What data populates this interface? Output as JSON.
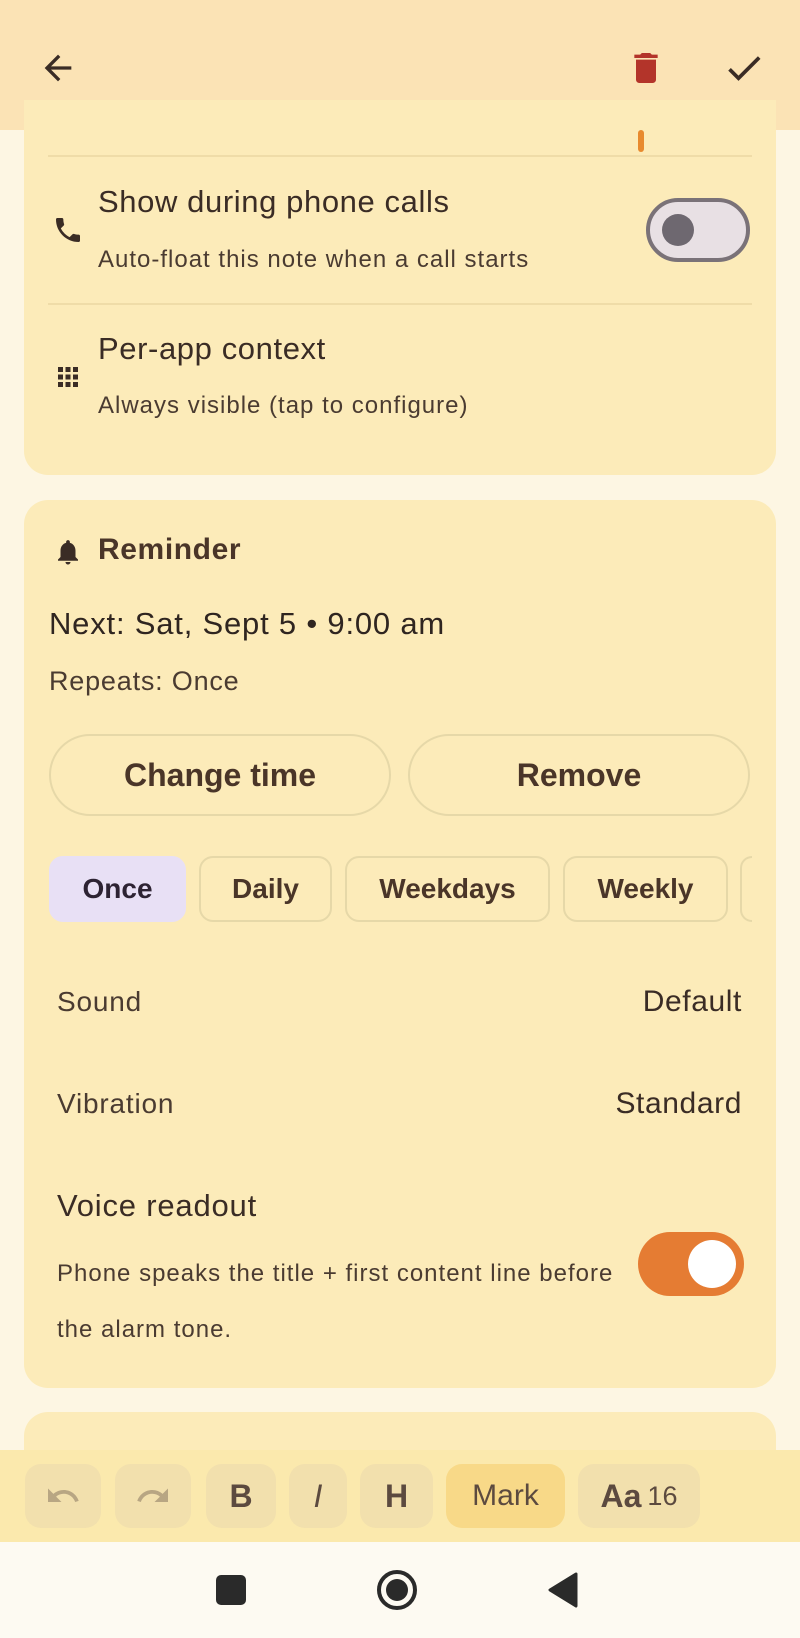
{
  "floating": {
    "phone_calls_title": "Show during phone calls",
    "phone_calls_sub": "Auto-float this note when a call starts",
    "phone_calls_on": false,
    "per_app_title": "Per-app context",
    "per_app_sub": "Always visible (tap to configure)"
  },
  "reminder": {
    "heading": "Reminder",
    "next": "Next: Sat, Sept 5 • 9:00 am",
    "repeats": "Repeats: Once",
    "change_time_label": "Change time",
    "remove_label": "Remove",
    "repeat_options": [
      "Once",
      "Daily",
      "Weekdays",
      "Weekly"
    ],
    "selected_repeat": "Once",
    "sound_label": "Sound",
    "sound_value": "Default",
    "vibration_label": "Vibration",
    "vibration_value": "Standard",
    "voice_title": "Voice readout",
    "voice_sub": "Phone speaks the title + first content line before the alarm tone.",
    "voice_on": true
  },
  "toolbar": {
    "bold": "B",
    "italic": "I",
    "heading": "H",
    "mark": "Mark",
    "font_label": "Aa",
    "font_size": "16"
  },
  "colors": {
    "accent": "#e57c33",
    "trash": "#b3342a",
    "card": "#fcebb9",
    "topbar": "#fbe3b5"
  },
  "icons": {
    "back": "arrow-left-icon",
    "delete": "trash-icon",
    "save": "check-icon",
    "phone": "phone-icon",
    "apps": "grid-icon",
    "bell": "bell-icon",
    "undo": "undo-icon",
    "redo": "redo-icon",
    "nav_recents": "square-icon",
    "nav_home": "circle-icon",
    "nav_back": "triangle-back-icon"
  }
}
